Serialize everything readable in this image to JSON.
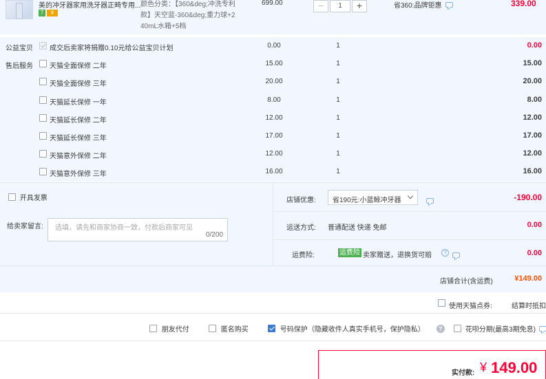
{
  "product": {
    "title": "美的冲牙器家用洗牙器正畸专用...",
    "badges": [
      "7",
      "¥"
    ],
    "sku_line1": "颜色分类：【360&deg;冲洗专利",
    "sku_line2": "款】天空蓝-360&deg;重力球+2",
    "sku_line3": "40mL水箱+5档",
    "price": "699.00",
    "qty_minus": "−",
    "qty": "1",
    "qty_plus": "+",
    "promo": "省360:品牌钜惠",
    "total": "339.00"
  },
  "charity": {
    "label": "公益宝贝",
    "text": "成交后卖家将捐赠0.10元给公益宝贝计划",
    "price": "0.00",
    "qty": "1",
    "total": "0.00"
  },
  "services": {
    "label": "售后服务",
    "items": [
      {
        "name": "天猫全面保修  二年",
        "price": "15.00",
        "qty": "1",
        "total": "15.00"
      },
      {
        "name": "天猫全面保修  三年",
        "price": "20.00",
        "qty": "1",
        "total": "20.00"
      },
      {
        "name": "天猫延长保修  一年",
        "price": "8.00",
        "qty": "1",
        "total": "8.00"
      },
      {
        "name": "天猫延长保修  二年",
        "price": "12.00",
        "qty": "1",
        "total": "12.00"
      },
      {
        "name": "天猫延长保修  三年",
        "price": "17.00",
        "qty": "1",
        "total": "17.00"
      },
      {
        "name": "天猫意外保修  二年",
        "price": "12.00",
        "qty": "1",
        "total": "12.00"
      },
      {
        "name": "天猫意外保修  三年",
        "price": "16.00",
        "qty": "1",
        "total": "16.00"
      }
    ]
  },
  "invoice": {
    "label": "开具发票"
  },
  "message": {
    "label": "给卖家留言:",
    "placeholder": "选填，请先和商家协商一致，付款后商家可见",
    "counter": "0/200"
  },
  "shop_discount": {
    "label": "店铺优惠:",
    "selected": "省190元:小蓝鲸冲牙器",
    "amount": "-190.00"
  },
  "shipping": {
    "label": "运送方式:",
    "text": "普通配送 快递 免邮",
    "amount": "0.00"
  },
  "insurance": {
    "label": "运费险:",
    "tag": "运费险",
    "text": "卖家赠送，退换货可赔",
    "amount": "0.00"
  },
  "shop_total": {
    "label": "店铺合计(含运费)",
    "amount": "¥149.00"
  },
  "points": {
    "label": "使用天猫点券:",
    "action": "结算时抵扣"
  },
  "options": [
    {
      "label": "朋友代付",
      "checked": false
    },
    {
      "label": "匿名购买",
      "checked": false
    },
    {
      "label": "号码保护（隐藏收件人真实手机号，保护隐私）",
      "checked": true
    },
    {
      "label": "花呗分期(最高3期免息)",
      "checked": false
    }
  ],
  "payment": {
    "label": "实付款:",
    "currency": "¥",
    "amount": "149.00"
  },
  "colors": {
    "accent": "#ff0036",
    "orange": "#ff5000",
    "blue_bg": "#f2f7ff",
    "link": "#3a7bd5"
  }
}
